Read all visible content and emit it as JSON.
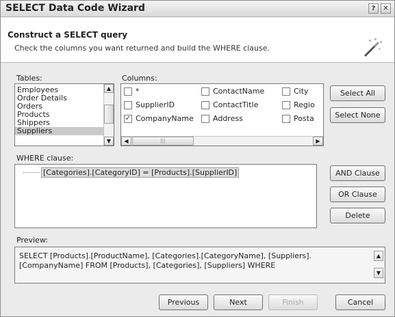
{
  "window": {
    "title": "SELECT Data Code Wizard"
  },
  "header": {
    "title": "Construct a SELECT query",
    "subtitle": "Check the columns you want returned and build the WHERE clause."
  },
  "tables": {
    "label": "Tables:",
    "items": [
      "Employees",
      "Order Details",
      "Orders",
      "Products",
      "Shippers",
      "Suppliers"
    ],
    "selected": "Suppliers"
  },
  "columns": {
    "label": "Columns:",
    "items": [
      {
        "name": "*",
        "checked": false
      },
      {
        "name": "ContactName",
        "checked": false
      },
      {
        "name": "City",
        "checked": false
      },
      {
        "name": "SupplierID",
        "checked": false
      },
      {
        "name": "ContactTitle",
        "checked": false
      },
      {
        "name": "Regio",
        "checked": false
      },
      {
        "name": "CompanyName",
        "checked": true
      },
      {
        "name": "Address",
        "checked": false
      },
      {
        "name": "Posta",
        "checked": false
      }
    ]
  },
  "buttons": {
    "select_all": "Select All",
    "select_none": "Select None",
    "and_clause": "AND Clause",
    "or_clause": "OR Clause",
    "delete": "Delete",
    "previous": "Previous",
    "next": "Next",
    "finish": "Finish",
    "cancel": "Cancel"
  },
  "where": {
    "label": "WHERE clause:",
    "items": [
      "[Categories].[CategoryID] = [Products].[SupplierID]"
    ]
  },
  "preview": {
    "label": "Preview:",
    "text": "SELECT [Products].[ProductName], [Categories].[CategoryName], [Suppliers].[CompanyName] FROM [Products], [Categories], [Suppliers] WHERE"
  }
}
